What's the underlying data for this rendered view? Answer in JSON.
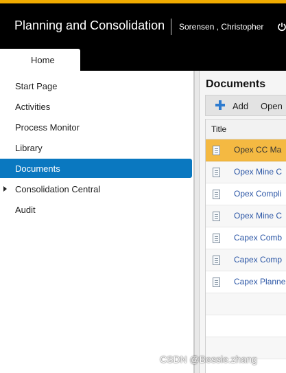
{
  "header": {
    "app_title": "Planning and Consolidation",
    "user_name": "Sorensen , Christopher",
    "accent_color": "#f0ab00",
    "power_icon": "power-icon"
  },
  "tabs": [
    {
      "label": "Home"
    }
  ],
  "sidebar": {
    "items": [
      {
        "label": "Start Page"
      },
      {
        "label": "Activities"
      },
      {
        "label": "Process Monitor"
      },
      {
        "label": "Library"
      },
      {
        "label": "Documents",
        "active": true
      },
      {
        "label": "Consolidation Central",
        "expandable": true
      },
      {
        "label": "Audit"
      }
    ],
    "active_color": "#0a78c0"
  },
  "main": {
    "title": "Documents",
    "toolbar": {
      "add_label": "Add",
      "open_label": "Open"
    },
    "table": {
      "columns": [
        "Title"
      ],
      "rows": [
        {
          "title": "Opex CC Ma"
        },
        {
          "title": "Opex Mine C"
        },
        {
          "title": "Opex Compli"
        },
        {
          "title": "Opex Mine C"
        },
        {
          "title": "Capex Comb"
        },
        {
          "title": "Capex Comp"
        },
        {
          "title": "Capex Planne"
        }
      ],
      "selected_row": 0,
      "selected_color": "#f4b942"
    }
  },
  "watermark": "CSDN @Bessie.zhang"
}
